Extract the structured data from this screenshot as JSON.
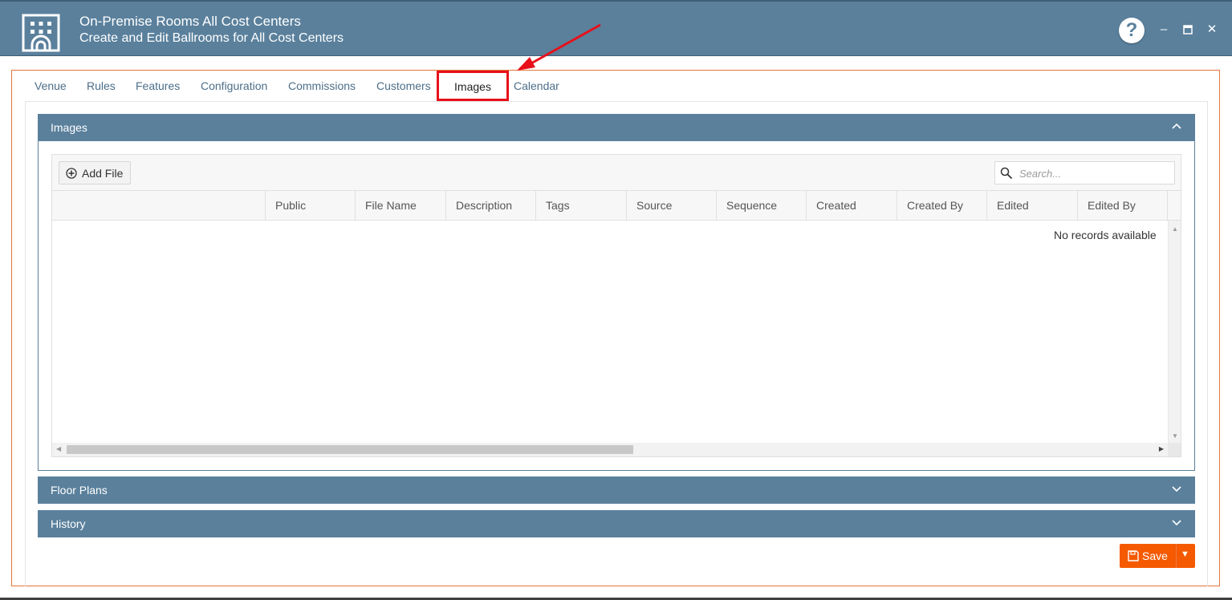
{
  "window": {
    "title": "On-Premise Rooms All Cost Centers",
    "subtitle": "Create and Edit Ballrooms for All Cost Centers",
    "help_label": "?",
    "minimize_label": "–",
    "maximize_label": "▫",
    "close_label": "✕"
  },
  "tabs": [
    {
      "label": "Venue"
    },
    {
      "label": "Rules"
    },
    {
      "label": "Features"
    },
    {
      "label": "Configuration"
    },
    {
      "label": "Commissions"
    },
    {
      "label": "Customers"
    },
    {
      "label": "Images",
      "active": true
    },
    {
      "label": "Calendar"
    }
  ],
  "panels": {
    "images": {
      "title": "Images",
      "expanded": true
    },
    "floor_plans": {
      "title": "Floor Plans",
      "expanded": false
    },
    "history": {
      "title": "History",
      "expanded": false
    }
  },
  "grid": {
    "add_button_label": "Add File",
    "search_placeholder": "Search...",
    "columns": [
      "Public",
      "File Name",
      "Description",
      "Tags",
      "Source",
      "Sequence",
      "Created",
      "Created By",
      "Edited",
      "Edited By"
    ],
    "empty_message": "No records available"
  },
  "actions": {
    "save_label": "Save"
  },
  "colors": {
    "header_bg": "#5a809c",
    "accent_orange": "#f55a00",
    "annotation_red": "#e8101a",
    "frame_border": "#e2763a"
  }
}
